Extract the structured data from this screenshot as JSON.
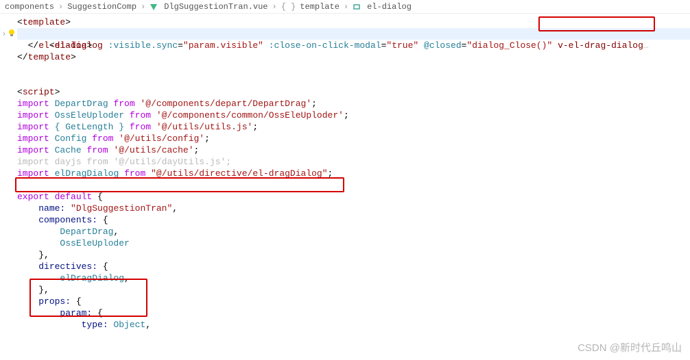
{
  "breadcrumb": {
    "items": [
      "components",
      "SuggestionComp",
      "DlgSuggestionTran.vue",
      "template",
      "el-dialog"
    ],
    "sep": "›",
    "braces": "{ }"
  },
  "code": {
    "l1": "template",
    "l2": {
      "tag": "el-dialog",
      "attr1": ":visible.sync",
      "val1": "\"param.visible\"",
      "attr2": ":close-on-click-modal",
      "val2": "\"true\"",
      "attr3": "@closed",
      "val3": "\"dialog_Close()\"",
      "attr4": "v-el-drag-dialog",
      "dots": "…"
    },
    "l3": "el-dialog",
    "l4": "template",
    "l5": "script",
    "imp": "import",
    "from": "from",
    "i1": {
      "name": "DepartDrag",
      "path": "'@/components/depart/DepartDrag'"
    },
    "i2": {
      "name": "OssEleUploder",
      "path": "'@/components/common/OssEleUploder'"
    },
    "i3": {
      "name": "{ GetLength }",
      "path": "'@/utils/utils.js'"
    },
    "i4": {
      "name": "Config",
      "path": "'@/utils/config'"
    },
    "i5": {
      "name": "Cache",
      "path": "'@/utils/cache'"
    },
    "i6": {
      "name": "dayjs",
      "path": "'@/utils/dayUtils.js'"
    },
    "i7": {
      "name": "elDragDialog",
      "path": "\"@/utils/directive/el-dragDialog\""
    },
    "exp": "export default",
    "name_k": "name:",
    "name_v": "\"DlgSuggestionTran\"",
    "comp_k": "components:",
    "comp1": "DepartDrag",
    "comp2": "OssEleUploder",
    "dir_k": "directives:",
    "dir1": "elDragDialog",
    "props_k": "props:",
    "param_k": "param:",
    "type_k": "type:",
    "type_v": "Object",
    "semi": ";",
    "comma": ",",
    "lbrace": "{",
    "rbrace": "}",
    "lt": "<",
    "gt": ">",
    "ltc": "</"
  },
  "watermark": "CSDN @新时代丘鸣山"
}
